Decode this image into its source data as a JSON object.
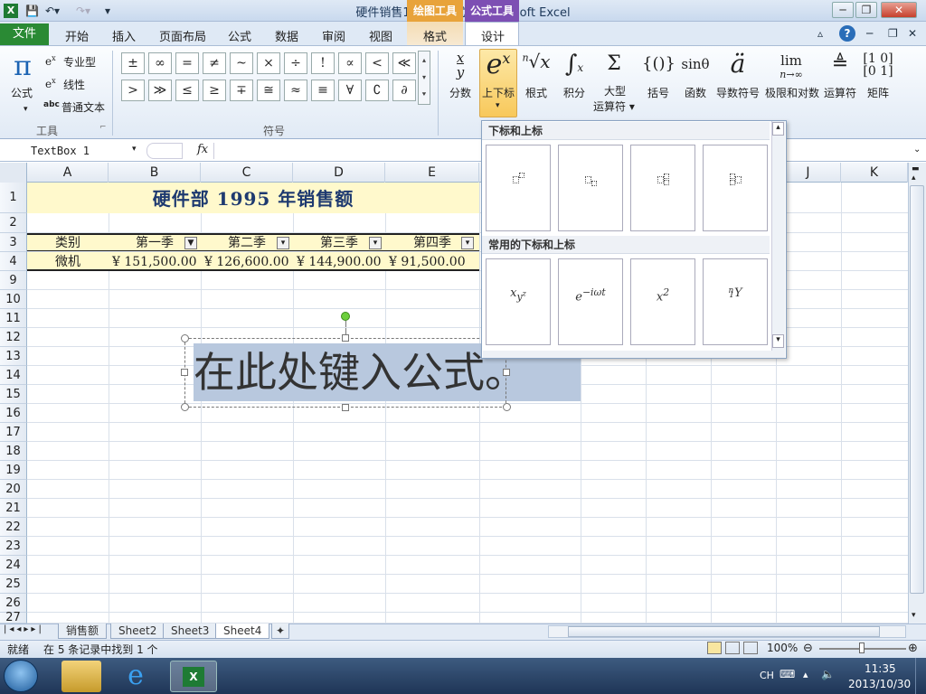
{
  "window": {
    "title": "硬件销售1 [兼容模式] - Microsoft Excel",
    "ctx_drawing": "绘图工具",
    "ctx_formula": "公式工具"
  },
  "tabs": {
    "file": "文件",
    "home": "开始",
    "insert": "插入",
    "layout": "页面布局",
    "formulas": "公式",
    "data": "数据",
    "review": "审阅",
    "view": "视图",
    "format": "格式",
    "design": "设计"
  },
  "ribbon": {
    "tools": {
      "equation": "公式",
      "professional": "专业型",
      "linear": "线性",
      "normal_text": "普通文本",
      "group": "工具"
    },
    "symbols": {
      "group": "符号",
      "row1": [
        "±",
        "∞",
        "=",
        "≠",
        "~",
        "×",
        "÷",
        "!",
        "∝",
        "<",
        "≪"
      ],
      "row2": [
        ">",
        "≫",
        "≤",
        "≥",
        "∓",
        "≅",
        "≈",
        "≡",
        "∀",
        "∁",
        "∂"
      ]
    },
    "structures": [
      {
        "label": "分数",
        "icon": "x/y"
      },
      {
        "label": "上下标",
        "icon": "eˣ"
      },
      {
        "label": "根式",
        "icon": "ⁿ√x"
      },
      {
        "label": "积分",
        "icon": "∫"
      },
      {
        "label": "大型\n运算符",
        "icon": "Σ"
      },
      {
        "label": "括号",
        "icon": "{()}"
      },
      {
        "label": "函数",
        "icon": "sinθ"
      },
      {
        "label": "导数符号",
        "icon": "ä"
      },
      {
        "label": "极限和对数",
        "icon": "lim"
      },
      {
        "label": "运算符",
        "icon": "△"
      },
      {
        "label": "矩阵",
        "icon": "[10;01]"
      }
    ]
  },
  "formula_bar": {
    "name_box": "TextBox 1",
    "fx": "fx"
  },
  "columns": [
    "A",
    "B",
    "C",
    "D",
    "E",
    "J",
    "K"
  ],
  "rows": [
    "1",
    "2",
    "3",
    "4",
    "9",
    "10",
    "11",
    "12",
    "13",
    "14",
    "15",
    "16",
    "17",
    "18",
    "19",
    "20",
    "21",
    "22",
    "23",
    "24",
    "25",
    "26",
    "27"
  ],
  "sheet": {
    "title": "硬件部 1995 年销售额",
    "headers": [
      "类别",
      "第一季",
      "第二季",
      "第三季",
      "第四季"
    ],
    "row4": {
      "category": "微机",
      "q1": "¥ 151,500.00",
      "q2": "¥ 126,600.00",
      "q3": "¥ 144,900.00",
      "q4": "¥ 91,500.00"
    }
  },
  "textbox": {
    "text": "在此处键入公式。"
  },
  "dropdown": {
    "section1": "下标和上标",
    "section2": "常用的下标和上标",
    "common": [
      "x_{y^z}",
      "e^{-iωt}",
      "x^2",
      "ⁿ₁Y"
    ]
  },
  "sheet_tabs": [
    "销售额",
    "Sheet2",
    "Sheet3",
    "Sheet4"
  ],
  "status": {
    "ready": "就绪",
    "found": "在 5 条记录中找到 1 个",
    "zoom": "100%"
  },
  "tray": {
    "lang": "CH",
    "time": "11:35",
    "date": "2013/10/30"
  }
}
